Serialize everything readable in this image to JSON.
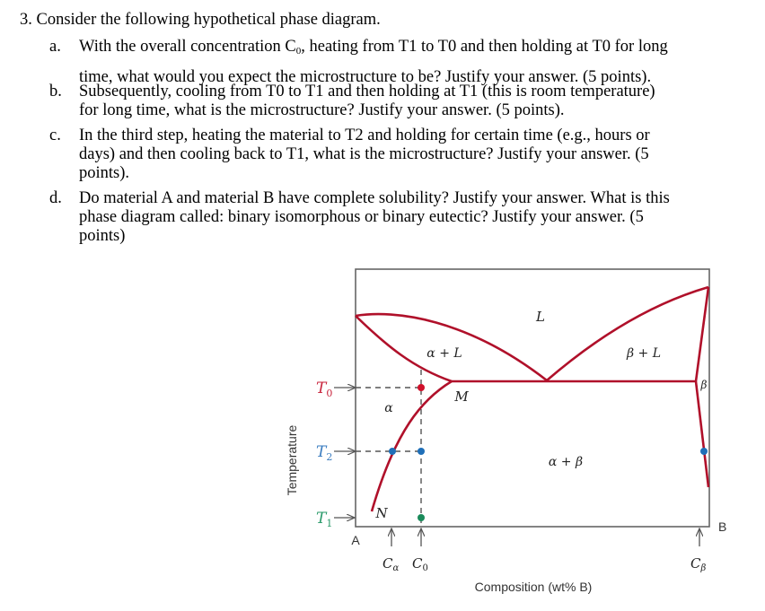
{
  "question": {
    "title": "3. Consider the following hypothetical phase diagram.",
    "items": [
      {
        "marker": "a.",
        "lines": [
          "With the overall concentration C",
          ", heating from T1 to T0 and then holding at T0 for long",
          "time, what would you expect the microstructure to be? Justify your answer. (5 points)."
        ],
        "concentration_subscript": "0"
      },
      {
        "marker": "b.",
        "lines": [
          "Subsequently, cooling from T0 to T1 and then holding at T1 (this is room temperature)",
          "for long time, what is the microstructure? Justify your answer. (5 points)."
        ]
      },
      {
        "marker": "c.",
        "lines": [
          "In the third step, heating the material to T2 and holding for certain time (e.g., hours or",
          "days) and then cooling back to T1, what is the microstructure? Justify your answer. (5",
          "points)."
        ]
      },
      {
        "marker": "d.",
        "lines": [
          "Do material A and material B have complete solubility? Justify your answer. What is this",
          "phase diagram called: binary isomorphous or binary eutectic? Justify your answer.  (5",
          "points)"
        ]
      }
    ]
  },
  "diagram": {
    "ylabel": "Temperature",
    "xlabel": "Composition (wt% B)",
    "left_component": "A",
    "right_component": "B",
    "regions": {
      "liquid": "L",
      "alpha_plus_liquid": "α + L",
      "beta_plus_liquid": "β + L",
      "alpha": "α",
      "beta": "β",
      "alpha_plus_beta": "α + β"
    },
    "points": {
      "M": "M",
      "N": "N"
    },
    "temperatures": [
      {
        "name": "T",
        "sub": "0",
        "color": "#c8243c"
      },
      {
        "name": "T",
        "sub": "2",
        "color": "#3a7cc0"
      },
      {
        "name": "T",
        "sub": "1",
        "color": "#2a9a6a"
      }
    ],
    "compositions": [
      {
        "name": "C",
        "sub": "α"
      },
      {
        "name": "C",
        "sub": "0"
      },
      {
        "name": "C",
        "sub": "β"
      }
    ],
    "colors": {
      "phase_line": "#b0102a",
      "axis": "#555555",
      "dot_T0": "#d0102a",
      "dot_T2": "#1f6fb8",
      "dot_T1": "#1a8a5a"
    }
  }
}
